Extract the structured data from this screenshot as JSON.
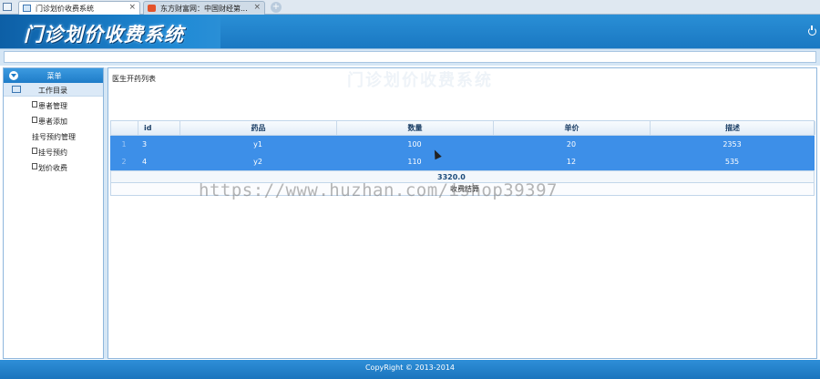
{
  "browser": {
    "tabs": [
      {
        "title": "门诊划价收费系统",
        "active": true
      },
      {
        "title": "东方财富网：中国财经第...",
        "active": false
      }
    ],
    "close_glyph": "×",
    "new_tab_glyph": "+"
  },
  "header": {
    "logo_text": "门诊划价收费系统"
  },
  "sidebar": {
    "title": "菜单",
    "folder": "工作目录",
    "items": [
      {
        "label": "患者管理",
        "icon": true
      },
      {
        "label": "患者添加",
        "icon": true
      },
      {
        "label": "挂号预约管理",
        "icon": false
      },
      {
        "label": "挂号预约",
        "icon": true
      },
      {
        "label": "划价收费",
        "icon": true
      }
    ]
  },
  "main": {
    "breadcrumb": "医生开药列表",
    "faint_title": "门诊划价收费系统",
    "grid": {
      "columns": {
        "id": "id",
        "drug": "药品",
        "qty": "数量",
        "price": "单价",
        "desc": "描述"
      },
      "rows": [
        {
          "index": "1",
          "id": "3",
          "drug": "y1",
          "qty": "100",
          "price": "20",
          "desc": "2353"
        },
        {
          "index": "2",
          "id": "4",
          "drug": "y2",
          "qty": "110",
          "price": "12",
          "desc": "535"
        }
      ],
      "total": "3320.0",
      "action_label": "收费结算"
    }
  },
  "watermark": "https://www.huzhan.com/ishop39397",
  "footer": {
    "copyright": "CopyRight © 2013-2014"
  },
  "colors": {
    "header_blue": "#1a78c2",
    "selection_blue": "#3d8fe8"
  }
}
